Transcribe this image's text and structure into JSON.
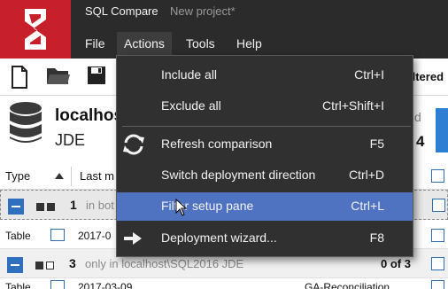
{
  "app": {
    "title": "SQL Compare",
    "project": "New project*",
    "logo": "redgate-logo"
  },
  "menu": {
    "items": [
      {
        "label": "File",
        "active": false
      },
      {
        "label": "Actions",
        "active": true
      },
      {
        "label": "Tools",
        "active": false
      },
      {
        "label": "Help",
        "active": false
      }
    ]
  },
  "toolbar": {
    "icons": [
      "new-file-icon",
      "open-folder-icon",
      "save-icon"
    ],
    "filtered_label": "iltered"
  },
  "server": {
    "name": "localhos",
    "database": "JDE",
    "right_letter": "d",
    "right_count": "4"
  },
  "columns": {
    "type": "Type",
    "last_modified": "Last m"
  },
  "rows": {
    "group1": {
      "number": "1",
      "text": "in bot"
    },
    "obj1": {
      "type": "Table",
      "date": "2017-0"
    },
    "group3": {
      "number": "3",
      "text": "only in localhost\\SQL2016 JDE",
      "count": "0 of 3"
    },
    "obj2": {
      "type": "Table",
      "date": "2017-03-09",
      "name": "GA-Reconciliation"
    }
  },
  "dropdown": {
    "items": [
      {
        "label": "Include all",
        "shortcut": "Ctrl+I",
        "icon": ""
      },
      {
        "label": "Exclude all",
        "shortcut": "Ctrl+Shift+I",
        "icon": ""
      },
      {
        "label": "Refresh comparison",
        "shortcut": "F5",
        "icon": "refresh-icon"
      },
      {
        "label": "Switch deployment direction",
        "shortcut": "Ctrl+D",
        "icon": ""
      },
      {
        "label": "Filter setup pane",
        "shortcut": "Ctrl+L",
        "icon": "",
        "highlighted": true
      },
      {
        "label": "Deployment wizard...",
        "shortcut": "F8",
        "icon": "arrow-right-icon"
      }
    ]
  },
  "colors": {
    "brand_red": "#c8202a",
    "dark_bar": "#2b2b2b",
    "menu_bg": "#303030",
    "highlight": "#4f73c1",
    "accent_blue": "#2e7fd4"
  }
}
